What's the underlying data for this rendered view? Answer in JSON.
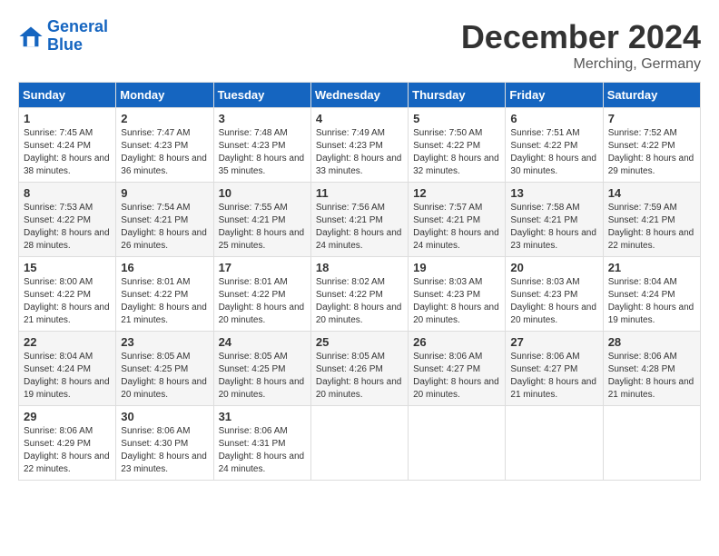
{
  "header": {
    "logo_line1": "General",
    "logo_line2": "Blue",
    "month_title": "December 2024",
    "location": "Merching, Germany"
  },
  "weekdays": [
    "Sunday",
    "Monday",
    "Tuesday",
    "Wednesday",
    "Thursday",
    "Friday",
    "Saturday"
  ],
  "weeks": [
    [
      {
        "day": "1",
        "sunrise": "7:45 AM",
        "sunset": "4:24 PM",
        "daylight": "8 hours and 38 minutes."
      },
      {
        "day": "2",
        "sunrise": "7:47 AM",
        "sunset": "4:23 PM",
        "daylight": "8 hours and 36 minutes."
      },
      {
        "day": "3",
        "sunrise": "7:48 AM",
        "sunset": "4:23 PM",
        "daylight": "8 hours and 35 minutes."
      },
      {
        "day": "4",
        "sunrise": "7:49 AM",
        "sunset": "4:23 PM",
        "daylight": "8 hours and 33 minutes."
      },
      {
        "day": "5",
        "sunrise": "7:50 AM",
        "sunset": "4:22 PM",
        "daylight": "8 hours and 32 minutes."
      },
      {
        "day": "6",
        "sunrise": "7:51 AM",
        "sunset": "4:22 PM",
        "daylight": "8 hours and 30 minutes."
      },
      {
        "day": "7",
        "sunrise": "7:52 AM",
        "sunset": "4:22 PM",
        "daylight": "8 hours and 29 minutes."
      }
    ],
    [
      {
        "day": "8",
        "sunrise": "7:53 AM",
        "sunset": "4:22 PM",
        "daylight": "8 hours and 28 minutes."
      },
      {
        "day": "9",
        "sunrise": "7:54 AM",
        "sunset": "4:21 PM",
        "daylight": "8 hours and 26 minutes."
      },
      {
        "day": "10",
        "sunrise": "7:55 AM",
        "sunset": "4:21 PM",
        "daylight": "8 hours and 25 minutes."
      },
      {
        "day": "11",
        "sunrise": "7:56 AM",
        "sunset": "4:21 PM",
        "daylight": "8 hours and 24 minutes."
      },
      {
        "day": "12",
        "sunrise": "7:57 AM",
        "sunset": "4:21 PM",
        "daylight": "8 hours and 24 minutes."
      },
      {
        "day": "13",
        "sunrise": "7:58 AM",
        "sunset": "4:21 PM",
        "daylight": "8 hours and 23 minutes."
      },
      {
        "day": "14",
        "sunrise": "7:59 AM",
        "sunset": "4:21 PM",
        "daylight": "8 hours and 22 minutes."
      }
    ],
    [
      {
        "day": "15",
        "sunrise": "8:00 AM",
        "sunset": "4:22 PM",
        "daylight": "8 hours and 21 minutes."
      },
      {
        "day": "16",
        "sunrise": "8:01 AM",
        "sunset": "4:22 PM",
        "daylight": "8 hours and 21 minutes."
      },
      {
        "day": "17",
        "sunrise": "8:01 AM",
        "sunset": "4:22 PM",
        "daylight": "8 hours and 20 minutes."
      },
      {
        "day": "18",
        "sunrise": "8:02 AM",
        "sunset": "4:22 PM",
        "daylight": "8 hours and 20 minutes."
      },
      {
        "day": "19",
        "sunrise": "8:03 AM",
        "sunset": "4:23 PM",
        "daylight": "8 hours and 20 minutes."
      },
      {
        "day": "20",
        "sunrise": "8:03 AM",
        "sunset": "4:23 PM",
        "daylight": "8 hours and 20 minutes."
      },
      {
        "day": "21",
        "sunrise": "8:04 AM",
        "sunset": "4:24 PM",
        "daylight": "8 hours and 19 minutes."
      }
    ],
    [
      {
        "day": "22",
        "sunrise": "8:04 AM",
        "sunset": "4:24 PM",
        "daylight": "8 hours and 19 minutes."
      },
      {
        "day": "23",
        "sunrise": "8:05 AM",
        "sunset": "4:25 PM",
        "daylight": "8 hours and 20 minutes."
      },
      {
        "day": "24",
        "sunrise": "8:05 AM",
        "sunset": "4:25 PM",
        "daylight": "8 hours and 20 minutes."
      },
      {
        "day": "25",
        "sunrise": "8:05 AM",
        "sunset": "4:26 PM",
        "daylight": "8 hours and 20 minutes."
      },
      {
        "day": "26",
        "sunrise": "8:06 AM",
        "sunset": "4:27 PM",
        "daylight": "8 hours and 20 minutes."
      },
      {
        "day": "27",
        "sunrise": "8:06 AM",
        "sunset": "4:27 PM",
        "daylight": "8 hours and 21 minutes."
      },
      {
        "day": "28",
        "sunrise": "8:06 AM",
        "sunset": "4:28 PM",
        "daylight": "8 hours and 21 minutes."
      }
    ],
    [
      {
        "day": "29",
        "sunrise": "8:06 AM",
        "sunset": "4:29 PM",
        "daylight": "8 hours and 22 minutes."
      },
      {
        "day": "30",
        "sunrise": "8:06 AM",
        "sunset": "4:30 PM",
        "daylight": "8 hours and 23 minutes."
      },
      {
        "day": "31",
        "sunrise": "8:06 AM",
        "sunset": "4:31 PM",
        "daylight": "8 hours and 24 minutes."
      },
      null,
      null,
      null,
      null
    ]
  ]
}
